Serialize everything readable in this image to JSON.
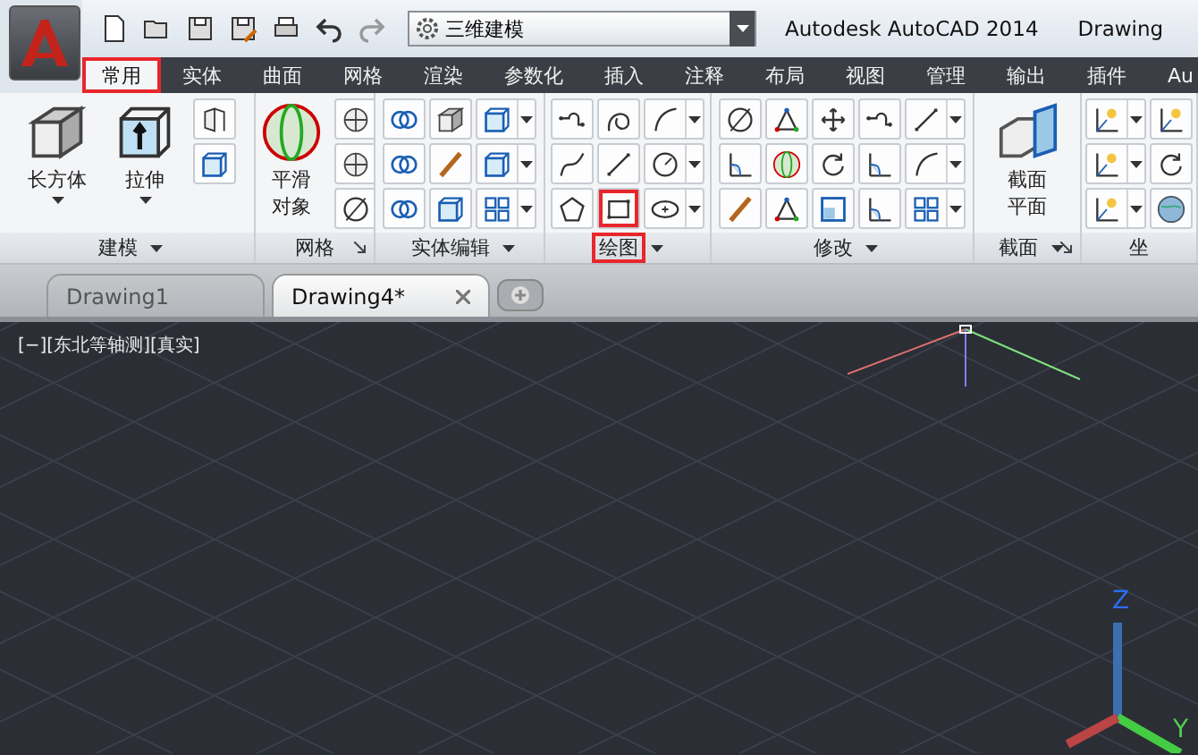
{
  "workspace": {
    "value": "三维建模"
  },
  "title": {
    "app": "Autodesk AutoCAD 2014",
    "document": "Drawing"
  },
  "ribbon_tabs": [
    {
      "label": "常用",
      "selected": true,
      "highlighted": true
    },
    {
      "label": "实体",
      "selected": false,
      "highlighted": false
    },
    {
      "label": "曲面",
      "selected": false,
      "highlighted": false
    },
    {
      "label": "网格",
      "selected": false,
      "highlighted": false
    },
    {
      "label": "渲染",
      "selected": false,
      "highlighted": false
    },
    {
      "label": "参数化",
      "selected": false,
      "highlighted": false
    },
    {
      "label": "插入",
      "selected": false,
      "highlighted": false
    },
    {
      "label": "注释",
      "selected": false,
      "highlighted": false
    },
    {
      "label": "布局",
      "selected": false,
      "highlighted": false
    },
    {
      "label": "视图",
      "selected": false,
      "highlighted": false
    },
    {
      "label": "管理",
      "selected": false,
      "highlighted": false
    },
    {
      "label": "输出",
      "selected": false,
      "highlighted": false
    },
    {
      "label": "插件",
      "selected": false,
      "highlighted": false
    },
    {
      "label": "Au",
      "selected": false,
      "highlighted": false
    }
  ],
  "panels": [
    {
      "title": "建模",
      "menu": true,
      "launcher": false,
      "highlighted": false,
      "large_tools": [
        {
          "label": "长方体",
          "menu": true
        },
        {
          "label": "拉伸",
          "menu": true
        }
      ],
      "columns": [
        {
          "dropdown": false,
          "tools": [
            {
              "highlighted": false
            },
            {
              "highlighted": false
            }
          ]
        }
      ]
    },
    {
      "title": "网格",
      "menu": false,
      "launcher": true,
      "highlighted": false,
      "large_tools": [
        {
          "label": "平滑对象",
          "menu": false
        }
      ],
      "columns": [
        {
          "dropdown": false,
          "tools": [
            {
              "highlighted": false
            },
            {
              "highlighted": false
            },
            {
              "highlighted": false
            }
          ]
        }
      ]
    },
    {
      "title": "实体编辑",
      "menu": true,
      "launcher": false,
      "highlighted": false,
      "columns": [
        {
          "dropdown": false,
          "tools": [
            {
              "highlighted": false
            },
            {
              "highlighted": false
            },
            {
              "highlighted": false
            }
          ]
        },
        {
          "dropdown": false,
          "tools": [
            {
              "highlighted": false
            },
            {
              "highlighted": false
            },
            {
              "highlighted": false
            }
          ]
        },
        {
          "dropdown": true,
          "tools": [
            {
              "highlighted": false
            },
            {
              "highlighted": false
            },
            {
              "highlighted": false
            }
          ]
        }
      ]
    },
    {
      "title": "绘图",
      "menu": true,
      "launcher": false,
      "highlighted": true,
      "columns": [
        {
          "dropdown": false,
          "tools": [
            {
              "highlighted": false
            },
            {
              "highlighted": false
            },
            {
              "highlighted": false
            }
          ]
        },
        {
          "dropdown": false,
          "tools": [
            {
              "highlighted": false
            },
            {
              "highlighted": false
            },
            {
              "highlighted": true
            }
          ]
        },
        {
          "dropdown": true,
          "tools": [
            {
              "highlighted": false
            },
            {
              "highlighted": false
            },
            {
              "highlighted": false
            }
          ]
        }
      ]
    },
    {
      "title": "修改",
      "menu": true,
      "launcher": false,
      "highlighted": false,
      "columns": [
        {
          "dropdown": false,
          "tools": [
            {
              "highlighted": false
            },
            {
              "highlighted": false
            },
            {
              "highlighted": false
            }
          ]
        },
        {
          "dropdown": false,
          "tools": [
            {
              "highlighted": false
            },
            {
              "highlighted": false
            },
            {
              "highlighted": false
            }
          ]
        },
        {
          "dropdown": false,
          "tools": [
            {
              "highlighted": false
            },
            {
              "highlighted": false
            },
            {
              "highlighted": false
            }
          ]
        },
        {
          "dropdown": false,
          "tools": [
            {
              "highlighted": false
            },
            {
              "highlighted": false
            },
            {
              "highlighted": false
            }
          ]
        },
        {
          "dropdown": true,
          "tools": [
            {
              "highlighted": false
            },
            {
              "highlighted": false
            },
            {
              "highlighted": false
            }
          ]
        }
      ]
    },
    {
      "title": "截面",
      "menu": true,
      "launcher": true,
      "highlighted": false,
      "large_tools": [
        {
          "label": "截面平面",
          "menu": false
        }
      ]
    },
    {
      "title": "坐",
      "menu": false,
      "launcher": false,
      "highlighted": false,
      "columns": [
        {
          "dropdown": true,
          "tools": [
            {
              "highlighted": false
            },
            {
              "highlighted": false
            },
            {
              "highlighted": false
            }
          ]
        },
        {
          "dropdown": false,
          "tools": [
            {
              "highlighted": false
            },
            {
              "highlighted": false
            },
            {
              "highlighted": false
            }
          ]
        }
      ]
    }
  ],
  "doc_tabs": [
    {
      "label": "Drawing1",
      "selected": false
    },
    {
      "label": "Drawing4*",
      "selected": true
    }
  ],
  "viewport": {
    "label": "[−][东北等轴测][真实]",
    "axis_labels": [
      "Z",
      "Y"
    ]
  }
}
